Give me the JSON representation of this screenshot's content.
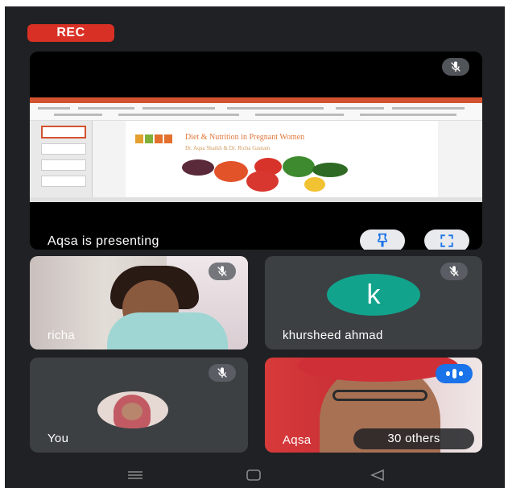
{
  "recording": {
    "label": "REC"
  },
  "presentation": {
    "presenter_label": "Aqsa is presenting",
    "slide_title": "Diet & Nutrition in Pregnant Women",
    "slide_authors": "Dr. Aqsa Shaikh & Dr. Richa Gautam",
    "pin_icon": "pin-icon",
    "fullscreen_icon": "fullscreen-icon",
    "mic_icon": "mic-off-icon"
  },
  "participants": [
    {
      "name": "richa",
      "muted": true
    },
    {
      "name": "khursheed ahmad",
      "initial": "k",
      "muted": true
    },
    {
      "name": "You",
      "muted": true
    },
    {
      "name": "Aqsa",
      "speaking": true
    }
  ],
  "others": {
    "label": "30 others"
  },
  "colors": {
    "background": "#202124",
    "tile": "#3c4043",
    "rec": "#d93025",
    "avatar_k": "#12a38c",
    "speaking": "#1a73e8"
  },
  "navigation": {
    "icons": [
      "menu-icon",
      "home-icon",
      "back-icon"
    ]
  }
}
